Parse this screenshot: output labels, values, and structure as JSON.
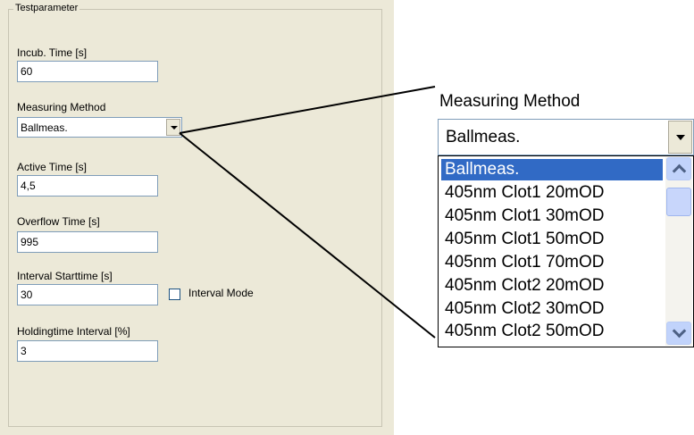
{
  "group_title": "Testparameter",
  "fields": [
    {
      "label": "Incub. Time [s]",
      "value": "60"
    },
    {
      "label": "Active Time [s]",
      "value": "4,5"
    },
    {
      "label": "Overflow Time [s]",
      "value": "995"
    },
    {
      "label": "Interval Starttime [s]",
      "value": "30"
    },
    {
      "label": "Holdingtime Interval [%]",
      "value": "3"
    }
  ],
  "measuring_method": {
    "label": "Measuring Method",
    "value": "Ballmeas."
  },
  "interval_mode": {
    "label": "Interval Mode",
    "checked": false
  },
  "zoom": {
    "label": "Measuring Method",
    "value": "Ballmeas.",
    "options": [
      "Ballmeas.",
      "405nm Clot1 20mOD",
      "405nm Clot1 30mOD",
      "405nm Clot1 50mOD",
      "405nm Clot1 70mOD",
      "405nm Clot2 20mOD",
      "405nm Clot2 30mOD",
      "405nm Clot2 50mOD"
    ],
    "selected_index": 0
  }
}
